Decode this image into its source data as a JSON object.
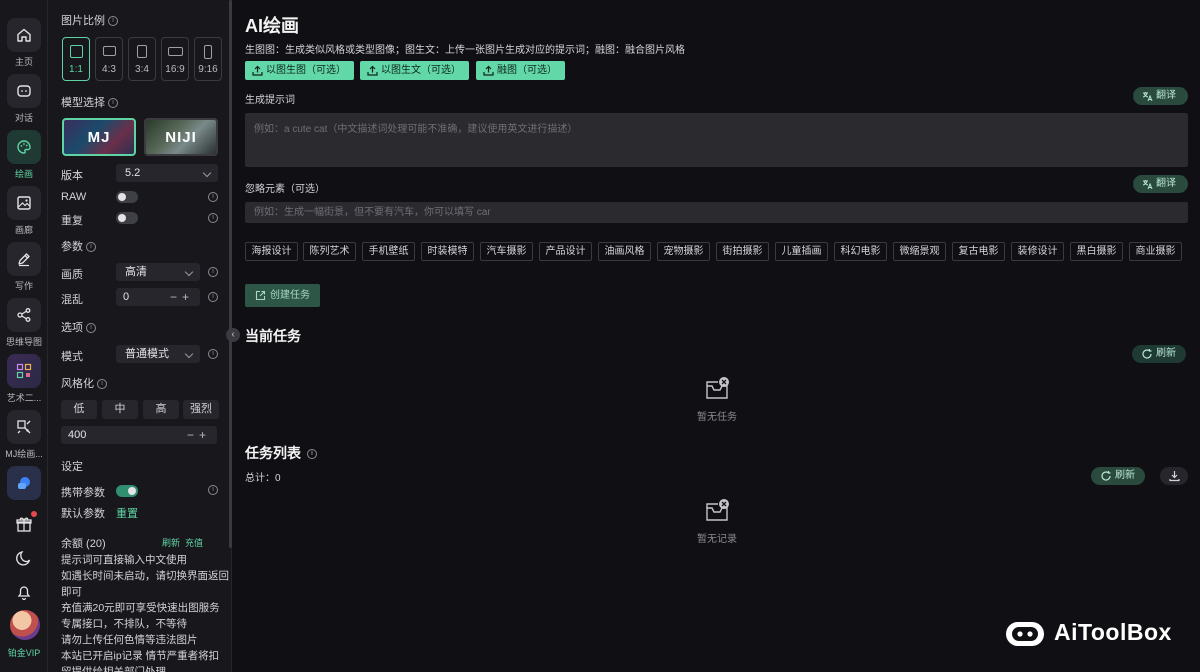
{
  "rail": {
    "items": [
      {
        "label": "主页",
        "icon": "home-icon"
      },
      {
        "label": "对话",
        "icon": "chat-icon"
      },
      {
        "label": "绘画",
        "icon": "palette-icon"
      },
      {
        "label": "画廊",
        "icon": "gallery-icon"
      },
      {
        "label": "写作",
        "icon": "pen-icon"
      },
      {
        "label": "思维导图",
        "icon": "mindmap-icon"
      },
      {
        "label": "艺术二...",
        "icon": "art-qr-icon"
      },
      {
        "label": "MJ绘画...",
        "icon": "mj-draw-icon"
      }
    ],
    "vip_label": "铂金VIP"
  },
  "panel": {
    "ratio_title": "图片比例",
    "ratios": [
      "1:1",
      "4:3",
      "3:4",
      "16:9",
      "9:16"
    ],
    "model_title": "模型选择",
    "models": [
      "MJ",
      "NIJI"
    ],
    "version_label": "版本",
    "version_value": "5.2",
    "raw_label": "RAW",
    "repeat_label": "重复",
    "params_title": "参数",
    "quality_label": "画质",
    "quality_value": "高清",
    "chaos_label": "混乱",
    "chaos_value": "0",
    "options_title": "选项",
    "mode_label": "模式",
    "mode_value": "普通模式",
    "stylize_title": "风格化",
    "stylize_options": [
      "低",
      "中",
      "高",
      "强烈"
    ],
    "stylize_value": "400",
    "settings_title": "设定",
    "carry_label": "携带参数",
    "default_label": "默认参数",
    "reset_label": "重置",
    "balance_label": "余额 (20)",
    "refresh_link": "刷新",
    "recharge_link": "充值",
    "tips": [
      "提示词可直接输入中文使用",
      "如遇长时间未启动，请切换界面返回即可",
      "充值满20元即可享受快速出图服务专属接口，不排队，不等待",
      "请勿上传任何色情等违法图片",
      "本站已开启ip记录 情节严重者将扣留提供给相关部门处理"
    ]
  },
  "main": {
    "title": "AI绘画",
    "description": "生图图：生成类似风格或类型图像；图生文：上传一张图片生成对应的提示词；融图：融合图片风格",
    "uploads": [
      "以图生图（可选）",
      "以图生文（可选）",
      "融图（可选）"
    ],
    "prompt_label": "生成提示词",
    "translate_label": "翻译",
    "prompt_placeholder": "例如：a cute cat（中文描述词处理可能不准确，建议使用英文进行描述）",
    "negative_label": "忽略元素（可选）",
    "negative_placeholder": "例如：生成一幅街景，但不要有汽车，你可以填写 car",
    "tags": [
      "海报设计",
      "陈列艺术",
      "手机壁纸",
      "时装模特",
      "汽车摄影",
      "产品设计",
      "油画风格",
      "宠物摄影",
      "街拍摄影",
      "儿童插画",
      "科幻电影",
      "微缩景观",
      "复古电影",
      "装修设计",
      "黑白摄影",
      "商业摄影"
    ],
    "create_label": "创建任务",
    "current_title": "当前任务",
    "refresh_label": "刷新",
    "no_task": "暂无任务",
    "list_title": "任务列表",
    "total_label": "总计：0",
    "no_record": "暂无记录"
  },
  "watermark": {
    "text": "AiToolBox"
  },
  "colors": {
    "accent": "#5fd3a4",
    "upload_bg": "#62d8a8",
    "bg": "#101014",
    "panel": "#18181c"
  }
}
